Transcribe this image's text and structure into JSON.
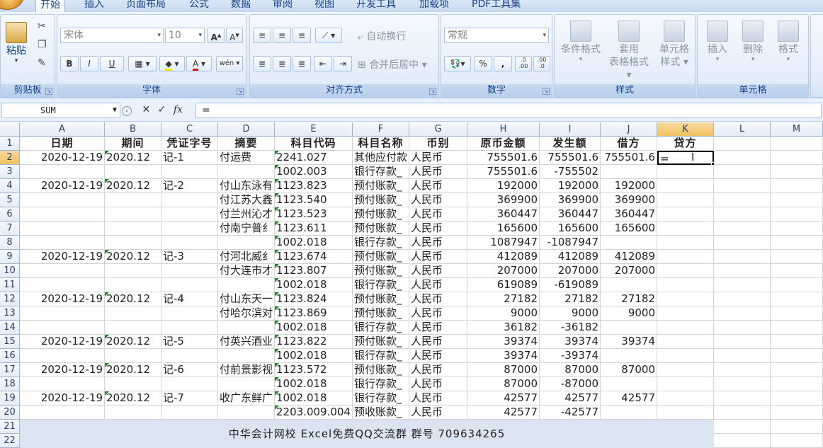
{
  "ribbon": {
    "tabs": [
      "开始",
      "插入",
      "页面布局",
      "公式",
      "数据",
      "审阅",
      "视图",
      "开发工具",
      "加载项",
      "PDF工具集"
    ],
    "groups": {
      "clipboard": {
        "label": "剪贴板",
        "paste": "粘贴"
      },
      "font": {
        "label": "字体",
        "font_name": "宋体",
        "font_size": "10",
        "bold": "B",
        "italic": "I",
        "underline": "U",
        "grow": "A",
        "shrink": "A",
        "font_color": "A",
        "phonetic": "wén"
      },
      "alignment": {
        "label": "对齐方式",
        "wrap_text": "自动换行",
        "merge_center": "合并后居中"
      },
      "number": {
        "label": "数字",
        "format": "常规",
        "percent": "%",
        "comma": ",",
        "inc_decimal": ".0 .00",
        "dec_decimal": ".00 .0"
      },
      "styles": {
        "label": "样式",
        "conditional": "条件格式",
        "table_format_1": "套用",
        "table_format_2": "表格格式",
        "cell_style_1": "单元格",
        "cell_style_2": "样式"
      },
      "cells": {
        "label": "单元格",
        "insert": "插入",
        "delete": "删除",
        "format": "格式"
      }
    }
  },
  "formula_bar": {
    "name_box": "SUM",
    "fx": "fx",
    "content": "="
  },
  "columns": [
    "A",
    "B",
    "C",
    "D",
    "E",
    "F",
    "G",
    "H",
    "I",
    "J",
    "K",
    "L",
    "M"
  ],
  "rows": [
    [
      "日期",
      "期间",
      "凭证字号",
      "摘要",
      "科目代码",
      "科目名称",
      "币别",
      "原币金额",
      "发生额",
      "借方",
      "贷方"
    ],
    [
      "2020-12-19",
      "2020.12",
      "记-1",
      "付运费",
      "2241.027",
      "其他应付款",
      "人民币",
      "755501.6",
      "755501.6",
      "755501.6",
      "="
    ],
    [
      "",
      "",
      "",
      "",
      "1002.003",
      "银行存款_",
      "人民币",
      "755501.6",
      "-755502",
      "",
      ""
    ],
    [
      "2020-12-19",
      "2020.12",
      "记-2",
      "付山东泳有",
      "1123.823",
      "预付账款_",
      "人民币",
      "192000",
      "192000",
      "192000",
      ""
    ],
    [
      "",
      "",
      "",
      "付江苏大鑫",
      "1123.540",
      "预付账款_",
      "人民币",
      "369900",
      "369900",
      "369900",
      ""
    ],
    [
      "",
      "",
      "",
      "付兰州沁才",
      "1123.523",
      "预付账款_",
      "人民币",
      "360447",
      "360447",
      "360447",
      ""
    ],
    [
      "",
      "",
      "",
      "付南宁普纟",
      "1123.611",
      "预付账款_",
      "人民币",
      "165600",
      "165600",
      "165600",
      ""
    ],
    [
      "",
      "",
      "",
      "",
      "1002.018",
      "银行存款_",
      "人民币",
      "1087947",
      "-1087947",
      "",
      ""
    ],
    [
      "2020-12-19",
      "2020.12",
      "记-3",
      "付河北威纟",
      "1123.674",
      "预付账款_",
      "人民币",
      "412089",
      "412089",
      "412089",
      ""
    ],
    [
      "",
      "",
      "",
      "付大连市才",
      "1123.807",
      "预付账款_",
      "人民币",
      "207000",
      "207000",
      "207000",
      ""
    ],
    [
      "",
      "",
      "",
      "",
      "1002.018",
      "银行存款_",
      "人民币",
      "619089",
      "-619089",
      "",
      ""
    ],
    [
      "2020-12-19",
      "2020.12",
      "记-4",
      "付山东天一",
      "1123.824",
      "预付账款_",
      "人民币",
      "27182",
      "27182",
      "27182",
      ""
    ],
    [
      "",
      "",
      "",
      "付哈尔滨对",
      "1123.869",
      "预付账款_",
      "人民币",
      "9000",
      "9000",
      "9000",
      ""
    ],
    [
      "",
      "",
      "",
      "",
      "1002.018",
      "银行存款_",
      "人民币",
      "36182",
      "-36182",
      "",
      ""
    ],
    [
      "2020-12-19",
      "2020.12",
      "记-5",
      "付英兴酒业",
      "1123.822",
      "预付账款_",
      "人民币",
      "39374",
      "39374",
      "39374",
      ""
    ],
    [
      "",
      "",
      "",
      "",
      "1002.018",
      "银行存款_",
      "人民币",
      "39374",
      "-39374",
      "",
      ""
    ],
    [
      "2020-12-19",
      "2020.12",
      "记-6",
      "付前景影视",
      "1123.572",
      "预付账款_",
      "人民币",
      "87000",
      "87000",
      "87000",
      ""
    ],
    [
      "",
      "",
      "",
      "",
      "1002.018",
      "银行存款_",
      "人民币",
      "87000",
      "-87000",
      "",
      ""
    ],
    [
      "2020-12-19",
      "2020.12",
      "记-7",
      "收广东鲜广",
      "1002.018",
      "银行存款_",
      "人民币",
      "42577",
      "42577",
      "42577",
      ""
    ],
    [
      "",
      "",
      "",
      "",
      "2203.009.004",
      "预收账款_",
      "人民币",
      "42577",
      "-42577",
      "",
      ""
    ]
  ],
  "banner": "中华会计网校 Excel免费QQ交流群 群号 709634265",
  "row_numbers": [
    "1",
    "2",
    "3",
    "4",
    "5",
    "6",
    "7",
    "8",
    "9",
    "10",
    "11",
    "12",
    "13",
    "14",
    "15",
    "16",
    "17",
    "18",
    "19",
    "20",
    "21",
    "22"
  ],
  "colors": {
    "accent": "#15428b",
    "selection": "#f1c15f",
    "banner_bg": "#dbe5f1"
  }
}
